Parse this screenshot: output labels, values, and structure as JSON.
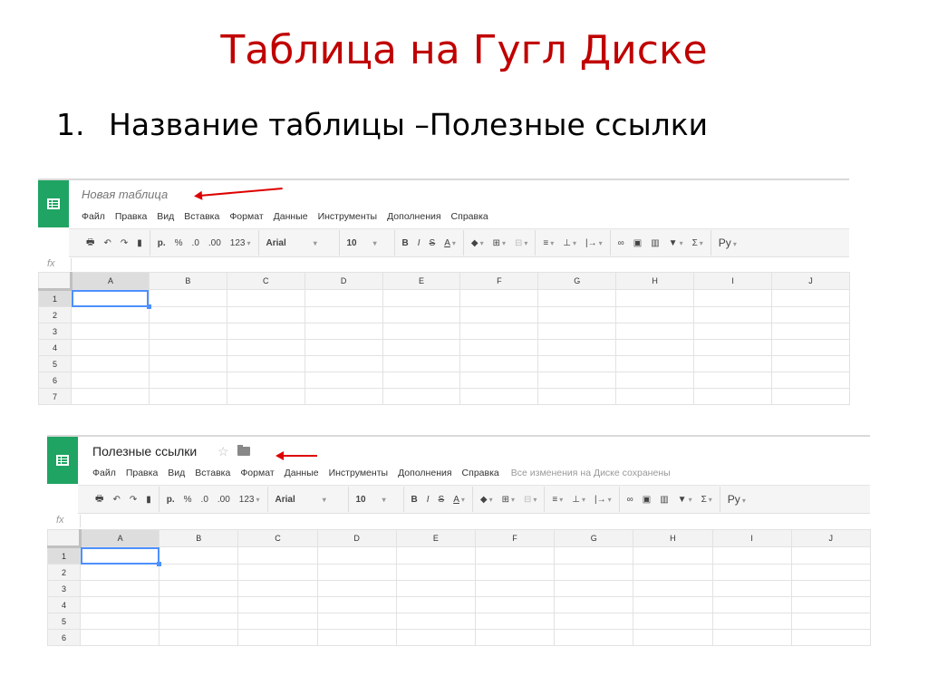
{
  "slide": {
    "title": "Таблица на Гугл Диске",
    "bullet_number": "1.",
    "bullet_text": "Название таблицы –Полезные ссылки"
  },
  "sheet1": {
    "doc_title": "Новая таблица",
    "menu": [
      "Файл",
      "Правка",
      "Вид",
      "Вставка",
      "Формат",
      "Данные",
      "Инструменты",
      "Дополнения",
      "Справка"
    ],
    "saved_status": "",
    "toolbar": {
      "currency": "р.",
      "percent": "%",
      "dec_decrease": ".0",
      "dec_increase": ".00",
      "number_format": "123",
      "font": "Arial",
      "font_size": "10",
      "lang": "Ру"
    },
    "fx": "fx",
    "columns": [
      "A",
      "B",
      "C",
      "D",
      "E",
      "F",
      "G",
      "H",
      "I",
      "J"
    ],
    "rows": [
      "1",
      "2",
      "3",
      "4",
      "5",
      "6",
      "7"
    ],
    "active_cell": "A1"
  },
  "sheet2": {
    "doc_title": "Полезные ссылки",
    "menu": [
      "Файл",
      "Правка",
      "Вид",
      "Вставка",
      "Формат",
      "Данные",
      "Инструменты",
      "Дополнения",
      "Справка"
    ],
    "saved_status": "Все изменения на Диске сохранены",
    "toolbar": {
      "currency": "р.",
      "percent": "%",
      "dec_decrease": ".0",
      "dec_increase": ".00",
      "number_format": "123",
      "font": "Arial",
      "font_size": "10",
      "lang": "Ру"
    },
    "fx": "fx",
    "columns": [
      "A",
      "B",
      "C",
      "D",
      "E",
      "F",
      "G",
      "H",
      "I",
      "J"
    ],
    "rows": [
      "1",
      "2",
      "3",
      "4",
      "5",
      "6"
    ],
    "active_cell": "A1"
  },
  "colors": {
    "title_red": "#c00000",
    "sheets_green": "#1fa463",
    "selection_blue": "#4d90fe",
    "arrow_red": "#dd0000"
  }
}
